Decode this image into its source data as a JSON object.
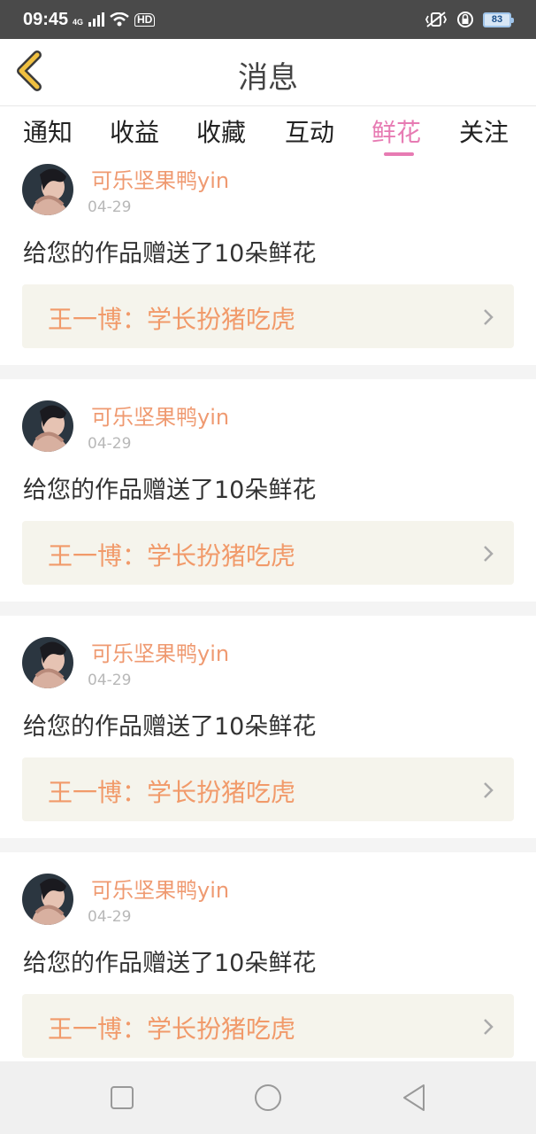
{
  "status_bar": {
    "time": "09:45",
    "network": "4G",
    "hd": "HD",
    "battery": "83"
  },
  "header": {
    "title": "消息",
    "back_icon": "chevron-left-icon",
    "accent_color": "#f0c040"
  },
  "tabs": [
    {
      "label": "通知",
      "active": false
    },
    {
      "label": "收益",
      "active": false
    },
    {
      "label": "收藏",
      "active": false
    },
    {
      "label": "互动",
      "active": false
    },
    {
      "label": "鲜花",
      "active": true
    },
    {
      "label": "关注",
      "active": false
    }
  ],
  "active_color": "#e77bb3",
  "messages": [
    {
      "user": "可乐坚果鸭yin",
      "date": "04-29",
      "content": "给您的作品赠送了10朵鲜花",
      "work": "王一博：学长扮猪吃虎"
    },
    {
      "user": "可乐坚果鸭yin",
      "date": "04-29",
      "content": "给您的作品赠送了10朵鲜花",
      "work": "王一博：学长扮猪吃虎"
    },
    {
      "user": "可乐坚果鸭yin",
      "date": "04-29",
      "content": "给您的作品赠送了10朵鲜花",
      "work": "王一博：学长扮猪吃虎"
    },
    {
      "user": "可乐坚果鸭yin",
      "date": "04-29",
      "content": "给您的作品赠送了10朵鲜花",
      "work": "王一博：学长扮猪吃虎"
    }
  ],
  "nav": {
    "recent_icon": "square-icon",
    "home_icon": "circle-icon",
    "back_icon": "triangle-back-icon"
  }
}
